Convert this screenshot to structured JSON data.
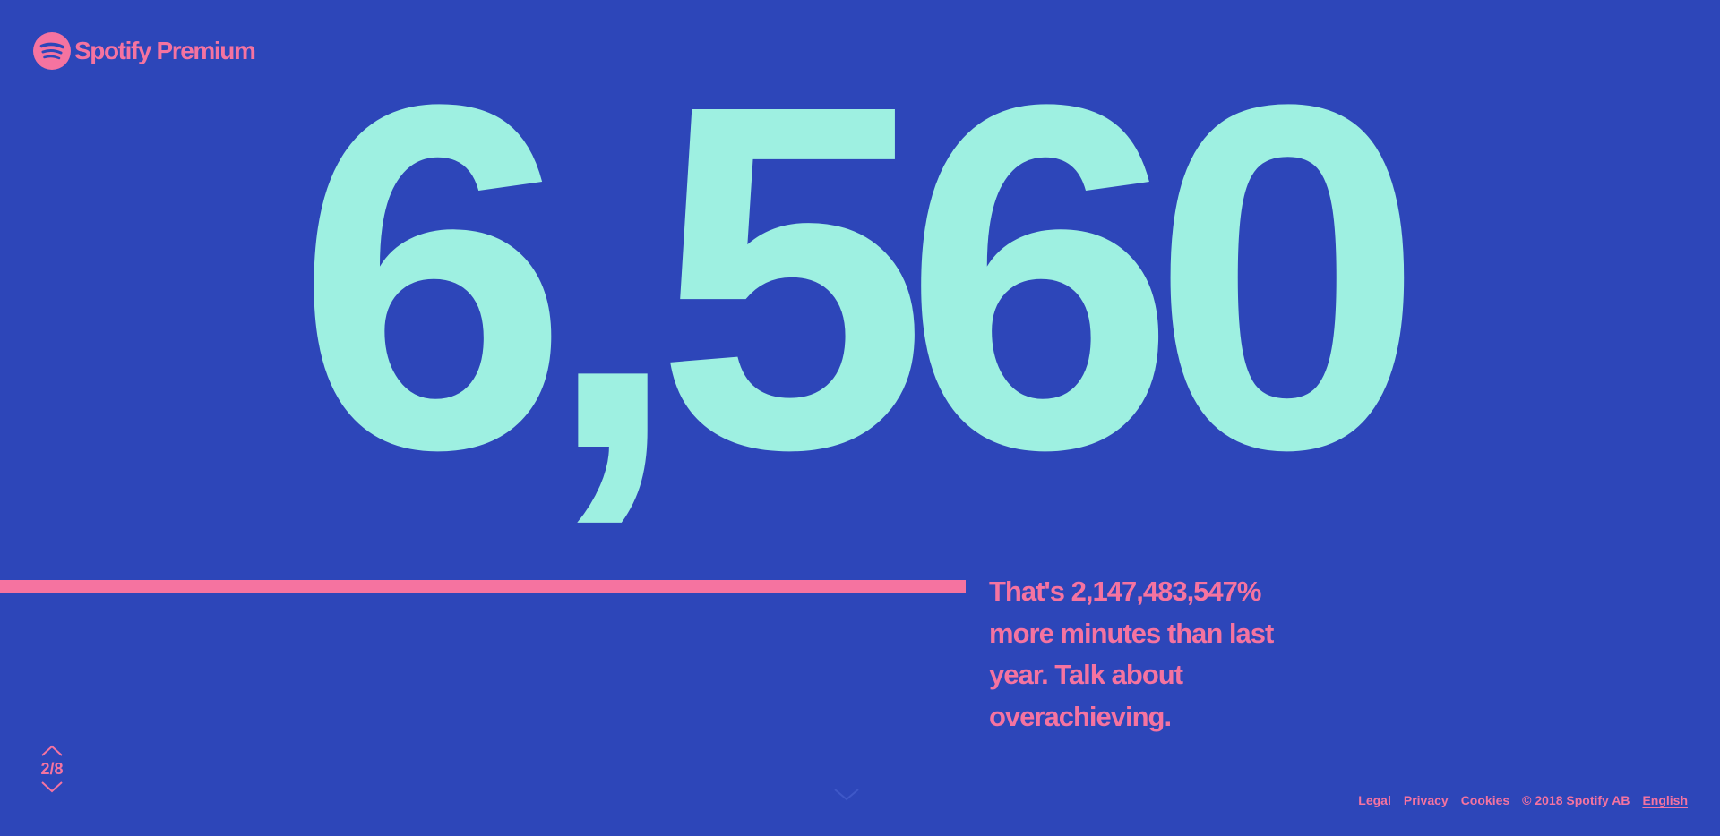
{
  "header": {
    "logo_text": "Spotify Premium",
    "logo_icon": "spotify-logo-icon"
  },
  "stat": {
    "number": "6,560",
    "caption": "That's 2,147,483,547% more minutes than last year. Talk about overachieving."
  },
  "progress": {
    "fill_fraction": 0.935
  },
  "pager": {
    "count": "2/8",
    "up_icon": "chevron-up-icon",
    "down_icon": "chevron-down-icon"
  },
  "footer": {
    "legal": "Legal",
    "privacy": "Privacy",
    "cookies": "Cookies",
    "copyright": "© 2018 Spotify AB",
    "language": "English"
  },
  "colors": {
    "background": "#2d46b9",
    "number": "#9ef0e1",
    "accent": "#f573a0"
  }
}
